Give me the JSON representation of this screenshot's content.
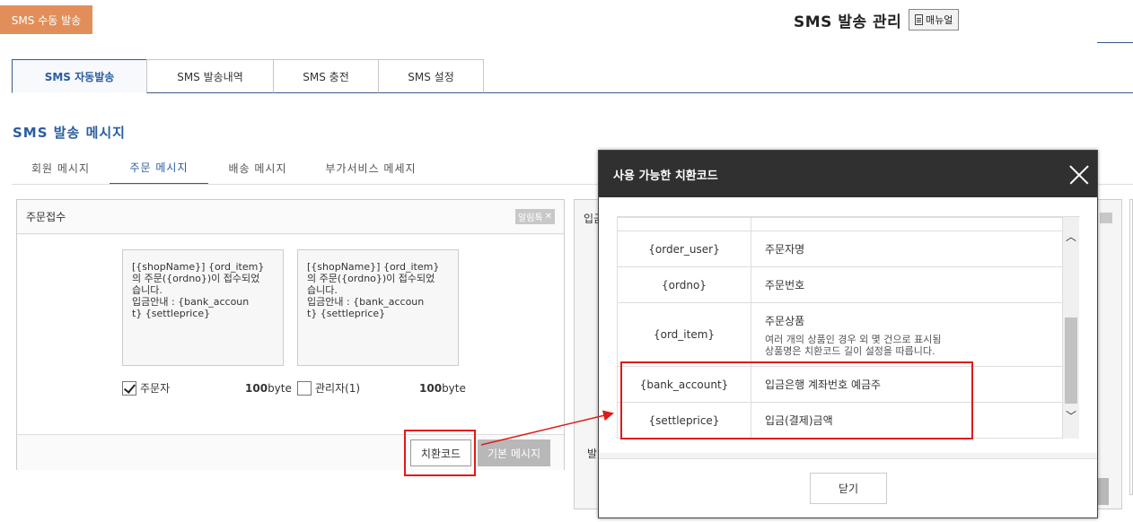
{
  "header": {
    "manual_send_label": "SMS 수동 발송",
    "title": "SMS 발송 관리",
    "manual_label": "매뉴얼"
  },
  "main_tabs": [
    {
      "label": "SMS 자동발송",
      "active": true
    },
    {
      "label": "SMS 발송내역",
      "active": false
    },
    {
      "label": "SMS 충전",
      "active": false
    },
    {
      "label": "SMS 설정",
      "active": false
    }
  ],
  "section_title": "SMS 발송 메시지",
  "sub_tabs": [
    {
      "label": "회원 메시지",
      "active": false
    },
    {
      "label": "주문 메시지",
      "active": true
    },
    {
      "label": "배송 메시지",
      "active": false
    },
    {
      "label": "부가서비스 메세지",
      "active": false
    }
  ],
  "left_card": {
    "title": "주문접수",
    "badge": "알림톡",
    "message_customer": "[{shopName}] {ord_item}\n의 주문({ordno})이 접수되었\n습니다.\n입금안내 : {bank_accoun\nt} {settleprice}",
    "message_admin": "[{shopName}] {ord_item}\n의 주문({ordno})이 접수되었\n습니다.\n입금안내 : {bank_accoun\nt} {settleprice}",
    "customer_label": "주문자",
    "customer_checked": true,
    "customer_bytes": "100",
    "admin_label": "관리자(1)",
    "admin_checked": false,
    "admin_bytes": "100",
    "byte_unit": "byte",
    "code_button": "치환코드",
    "default_button": "기본 메시지"
  },
  "right_card": {
    "title_partial": "입금",
    "footer_partial": "발"
  },
  "modal": {
    "title": "사용 가능한 치환코드",
    "rows": [
      {
        "code": "",
        "desc": ""
      },
      {
        "code": "{order_user}",
        "desc": "주문자명"
      },
      {
        "code": "{ordno}",
        "desc": "주문번호"
      },
      {
        "code": "{ord_item}",
        "desc": "주문상품",
        "note": "여러 개의 상품인 경우 외 몇 건으로 표시됨\n상품명은 치환코드 길이 설정을 따릅니다."
      },
      {
        "code": "{bank_account}",
        "desc": "입금은행 계좌번호 예금주"
      },
      {
        "code": "{settleprice}",
        "desc": "입금(결제)금액"
      }
    ],
    "close_label": "닫기"
  },
  "colors": {
    "accent": "#2a5d9f",
    "manual_send_bg": "#e28e5a",
    "highlight": "#e01a1a",
    "modal_header": "#303030"
  }
}
